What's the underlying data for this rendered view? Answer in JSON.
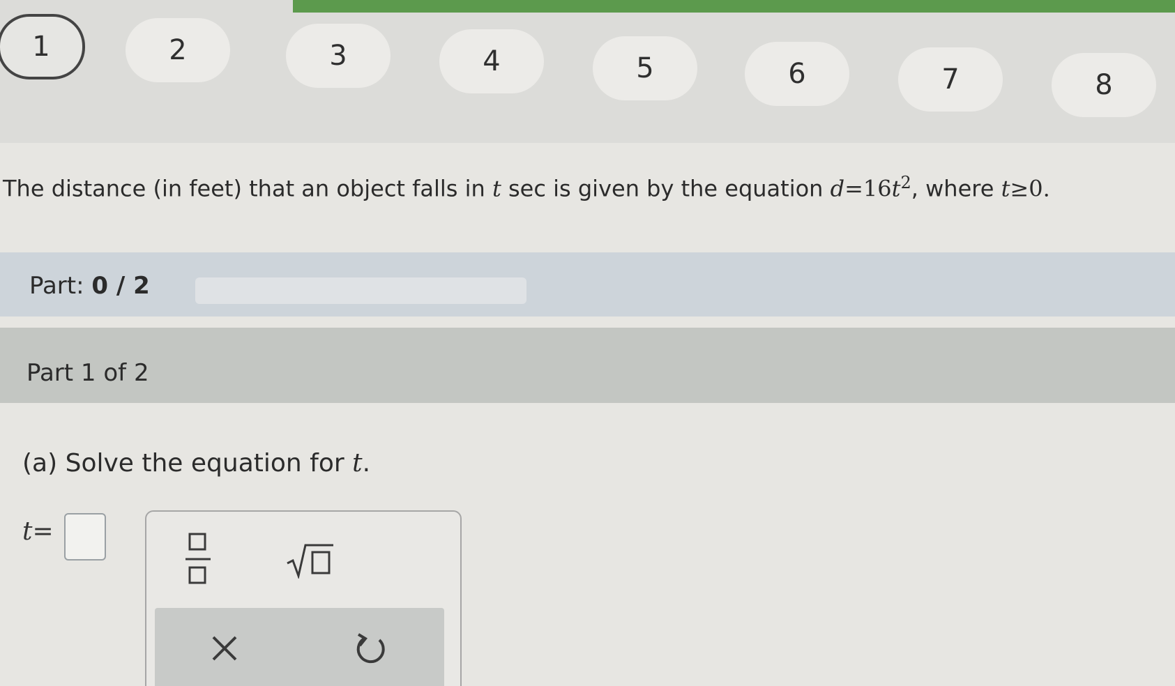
{
  "nav": {
    "steps": [
      "1",
      "2",
      "3",
      "4",
      "5",
      "6",
      "7",
      "8"
    ],
    "active_step": "1"
  },
  "question": {
    "lead": "The distance (in feet) that an object falls in",
    "var_t": "t",
    "mid": "sec is given by the equation",
    "equation_lhs": "d",
    "equation_eq": "=16",
    "equation_t": "t",
    "equation_exp": "2",
    "tail": ", where",
    "cond_t": "t",
    "cond_rest": "≥0."
  },
  "part_progress": {
    "label": "Part:",
    "value": "0 / 2",
    "fraction": 0
  },
  "part_header": "Part 1 of 2",
  "prompt": {
    "prefix": "(a) Solve the equation for",
    "var": "t",
    "suffix": "."
  },
  "answer": {
    "var": "t",
    "eq": "="
  },
  "tools": {
    "fraction": "fraction-icon",
    "sqrt": "square-root-icon",
    "clear": "×",
    "undo": "undo-icon"
  },
  "colors": {
    "accent": "#5c9a4d",
    "band_part": "#cdd4da",
    "band_part1": "#c3c6c2"
  }
}
